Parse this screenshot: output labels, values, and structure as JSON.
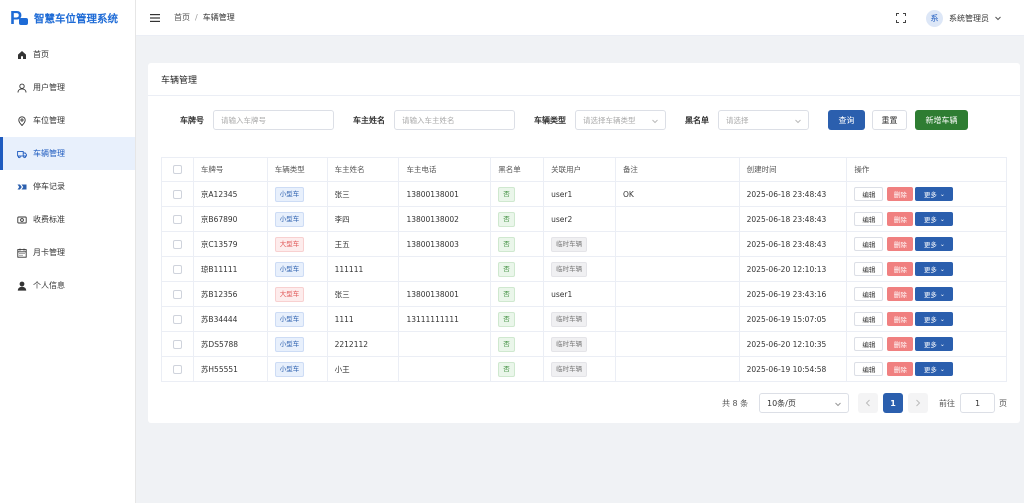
{
  "app": {
    "title": "智慧车位管理系统"
  },
  "sidebar": {
    "items": [
      {
        "label": "首页",
        "icon": "home-icon"
      },
      {
        "label": "用户管理",
        "icon": "user-icon"
      },
      {
        "label": "车位管理",
        "icon": "location-icon"
      },
      {
        "label": "车辆管理",
        "icon": "truck-icon",
        "active": true
      },
      {
        "label": "停车记录",
        "icon": "parking-record-icon"
      },
      {
        "label": "收费标准",
        "icon": "fee-icon"
      },
      {
        "label": "月卡管理",
        "icon": "calendar-icon"
      },
      {
        "label": "个人信息",
        "icon": "person-icon"
      }
    ]
  },
  "header": {
    "breadcrumb": {
      "home": "首页",
      "separator": "/",
      "current": "车辆管理"
    },
    "user": {
      "avatar_text": "系",
      "name": "系统管理员"
    }
  },
  "card": {
    "title": "车辆管理"
  },
  "filters": {
    "plate": {
      "label": "车牌号",
      "placeholder": "请输入车牌号"
    },
    "owner": {
      "label": "车主姓名",
      "placeholder": "请输入车主姓名"
    },
    "type": {
      "label": "车辆类型",
      "placeholder": "请选择车辆类型"
    },
    "blacklist": {
      "label": "黑名单",
      "placeholder": "请选择"
    },
    "query_label": "查询",
    "reset_label": "重置",
    "add_label": "新增车辆"
  },
  "table": {
    "headers": [
      "车牌号",
      "车辆类型",
      "车主姓名",
      "车主电话",
      "黑名单",
      "关联用户",
      "备注",
      "创建时间",
      "操作"
    ],
    "rows": [
      {
        "plate": "京A12345",
        "type": "小型车",
        "type_kind": "small",
        "owner": "张三",
        "phone": "13800138001",
        "blacklist": "否",
        "user": "user1",
        "user_is_temp": false,
        "remark": "OK",
        "created": "2025-06-18 23:48:43"
      },
      {
        "plate": "京B67890",
        "type": "小型车",
        "type_kind": "small",
        "owner": "李四",
        "phone": "13800138002",
        "blacklist": "否",
        "user": "user2",
        "user_is_temp": false,
        "remark": "",
        "created": "2025-06-18 23:48:43"
      },
      {
        "plate": "京C13579",
        "type": "大型车",
        "type_kind": "large",
        "owner": "王五",
        "phone": "13800138003",
        "blacklist": "否",
        "user": "临时车辆",
        "user_is_temp": true,
        "remark": "",
        "created": "2025-06-18 23:48:43"
      },
      {
        "plate": "琼B11111",
        "type": "小型车",
        "type_kind": "small",
        "owner": "111111",
        "phone": "",
        "blacklist": "否",
        "user": "临时车辆",
        "user_is_temp": true,
        "remark": "",
        "created": "2025-06-20 12:10:13"
      },
      {
        "plate": "苏B12356",
        "type": "大型车",
        "type_kind": "large",
        "owner": "张三",
        "phone": "13800138001",
        "blacklist": "否",
        "user": "user1",
        "user_is_temp": false,
        "remark": "",
        "created": "2025-06-19 23:43:16"
      },
      {
        "plate": "苏B34444",
        "type": "小型车",
        "type_kind": "small",
        "owner": "1111",
        "phone": "13111111111",
        "blacklist": "否",
        "user": "临时车辆",
        "user_is_temp": true,
        "remark": "",
        "created": "2025-06-19 15:07:05"
      },
      {
        "plate": "苏DS5788",
        "type": "小型车",
        "type_kind": "small",
        "owner": "2212112",
        "phone": "",
        "blacklist": "否",
        "user": "临时车辆",
        "user_is_temp": true,
        "remark": "",
        "created": "2025-06-20 12:10:35"
      },
      {
        "plate": "苏H55551",
        "type": "小型车",
        "type_kind": "small",
        "owner": "小王",
        "phone": "",
        "blacklist": "否",
        "user": "临时车辆",
        "user_is_temp": true,
        "remark": "",
        "created": "2025-06-19 10:54:58"
      }
    ],
    "actions": {
      "edit": "编辑",
      "delete": "删除",
      "more": "更多"
    }
  },
  "pagination": {
    "total_text": "共 8 条",
    "page_size": "10条/页",
    "current_page": "1",
    "goto_label": "前往",
    "goto_value": "1",
    "page_suffix": "页"
  },
  "colors": {
    "primary": "#2b5fae",
    "success": "#2e7d32",
    "danger": "#f08080",
    "brand": "#1e6bd6"
  }
}
